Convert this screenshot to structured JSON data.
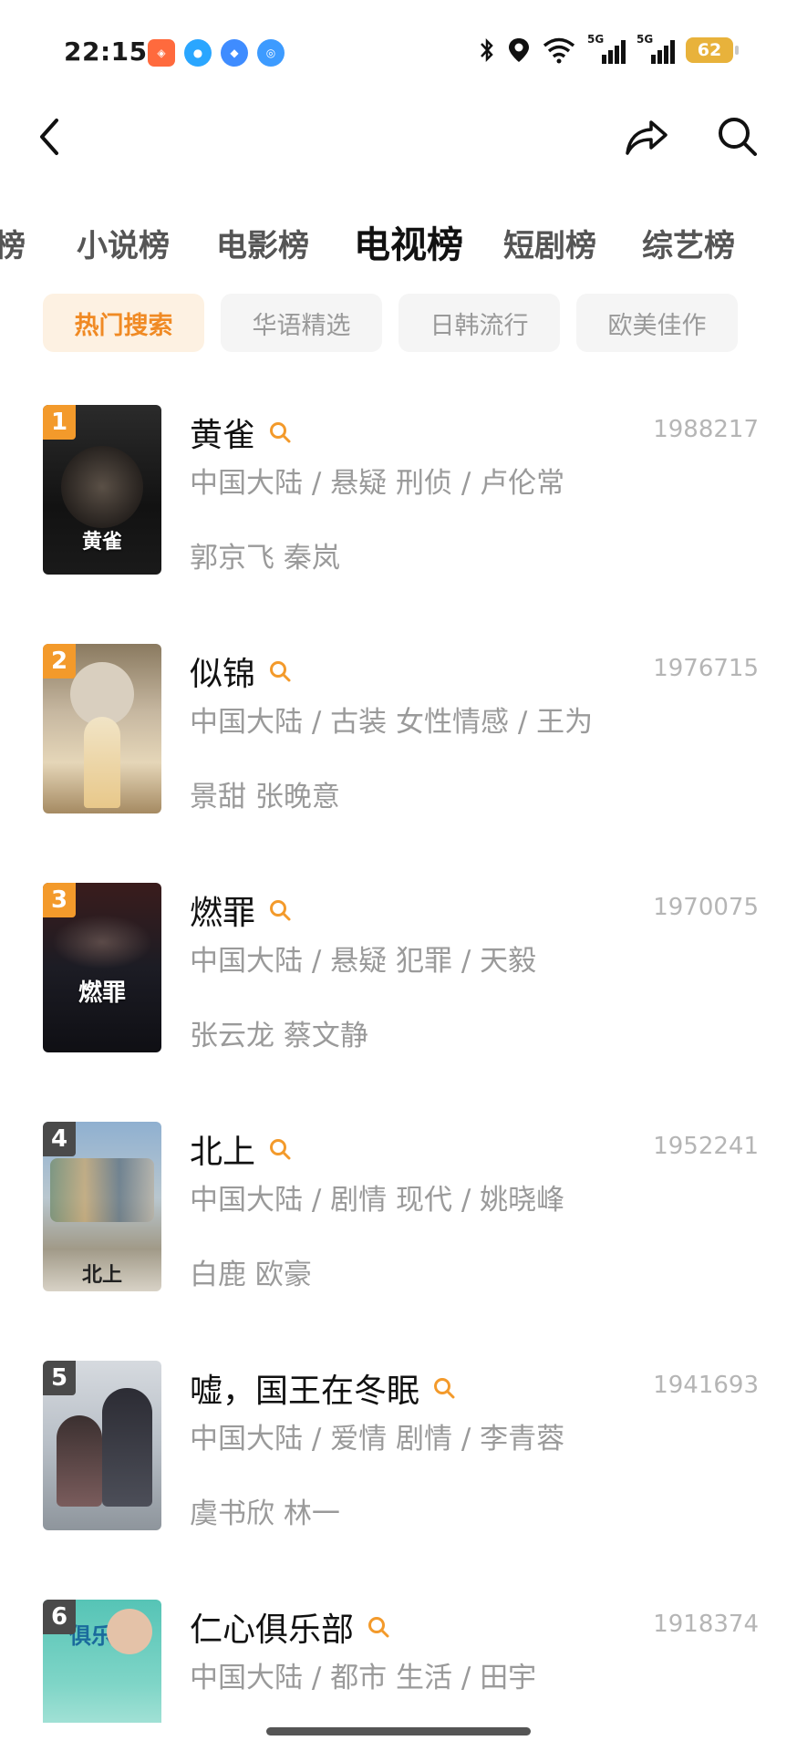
{
  "status_bar": {
    "time": "22:15",
    "battery": "62",
    "network_1": "5G",
    "network_2": "5G"
  },
  "category_tabs": [
    "榜",
    "小说榜",
    "电影榜",
    "电视榜",
    "短剧榜",
    "综艺榜"
  ],
  "active_category": "电视榜",
  "sub_tabs": [
    "热门搜索",
    "华语精选",
    "日韩流行",
    "欧美佳作"
  ],
  "active_sub_tab": "热门搜索",
  "items": [
    {
      "rank": "1",
      "title": "黄雀",
      "score": "1988217",
      "meta": "中国大陆 / 悬疑 刑侦 / 卢伦常",
      "cast": "郭京飞 秦岚",
      "poster_text": "黄雀"
    },
    {
      "rank": "2",
      "title": "似锦",
      "score": "1976715",
      "meta": "中国大陆 / 古装 女性情感 / 王为",
      "cast": "景甜 张晚意",
      "poster_text": ""
    },
    {
      "rank": "3",
      "title": "燃罪",
      "score": "1970075",
      "meta": "中国大陆 / 悬疑 犯罪 / 天毅",
      "cast": "张云龙 蔡文静",
      "poster_text": "燃罪"
    },
    {
      "rank": "4",
      "title": "北上",
      "score": "1952241",
      "meta": "中国大陆 / 剧情 现代 / 姚晓峰",
      "cast": "白鹿 欧豪",
      "poster_text": "北上"
    },
    {
      "rank": "5",
      "title": "嘘，国王在冬眠",
      "score": "1941693",
      "meta": "中国大陆 / 爱情 剧情 / 李青蓉",
      "cast": "虞书欣 林一",
      "poster_text": ""
    },
    {
      "rank": "6",
      "title": "仁心俱乐部",
      "score": "1918374",
      "meta": "中国大陆 / 都市 生活 / 田宇",
      "cast": "",
      "poster_text": "俱乐部"
    }
  ],
  "colors": {
    "accent": "#f39a2b",
    "sub_tab_active_bg": "#fdf1e2",
    "rank_hot": "#f39a2b",
    "rank_cold": "#4a4a4a"
  },
  "icons": [
    "back-icon",
    "share-icon",
    "search-icon",
    "title-search-icon"
  ]
}
